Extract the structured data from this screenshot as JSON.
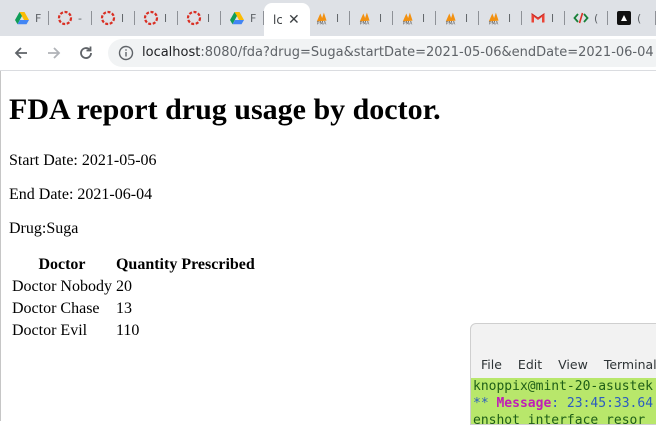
{
  "browser": {
    "tabs": [
      {
        "icon": "google-drive-icon",
        "title": "F"
      },
      {
        "icon": "red-circle-icon",
        "title": "-"
      },
      {
        "icon": "red-circle-icon",
        "title": "l"
      },
      {
        "icon": "red-circle-icon",
        "title": "l"
      },
      {
        "icon": "red-circle-icon",
        "title": "l"
      },
      {
        "icon": "google-drive-icon",
        "title": "F"
      },
      {
        "icon": "none",
        "title": "lc",
        "active": true
      },
      {
        "icon": "phpmyadmin-icon",
        "title": "l"
      },
      {
        "icon": "phpmyadmin-icon",
        "title": "l"
      },
      {
        "icon": "phpmyadmin-icon",
        "title": "l"
      },
      {
        "icon": "phpmyadmin-icon",
        "title": "l"
      },
      {
        "icon": "phpmyadmin-icon",
        "title": "l"
      },
      {
        "icon": "gmail-icon",
        "title": "l"
      },
      {
        "icon": "code-icon",
        "title": "("
      },
      {
        "icon": "black-square-icon",
        "title": "("
      }
    ],
    "url_host": "localhost",
    "url_rest": ":8080/fda?drug=Suga&startDate=2021-05-06&endDate=2021-06-04"
  },
  "page": {
    "title": "FDA report drug usage by doctor.",
    "start_date": "Start Date: 2021-05-06",
    "end_date": "End Date: 2021-06-04",
    "drug": "Drug:Suga",
    "table": {
      "headers": [
        "Doctor",
        "Quantity Prescribed"
      ],
      "rows": [
        [
          "Doctor Nobody",
          "20"
        ],
        [
          "Doctor Chase",
          "13"
        ],
        [
          "Doctor Evil",
          "110"
        ]
      ]
    }
  },
  "terminal": {
    "menu": [
      "File",
      "Edit",
      "View",
      "Terminal"
    ],
    "prompt": "knoppix@mint-20-asustek",
    "msg_stars": "**",
    "msg_label": "Message",
    "msg_time": ": 23:45:33.64",
    "line3": "enshot_interface  resor"
  }
}
